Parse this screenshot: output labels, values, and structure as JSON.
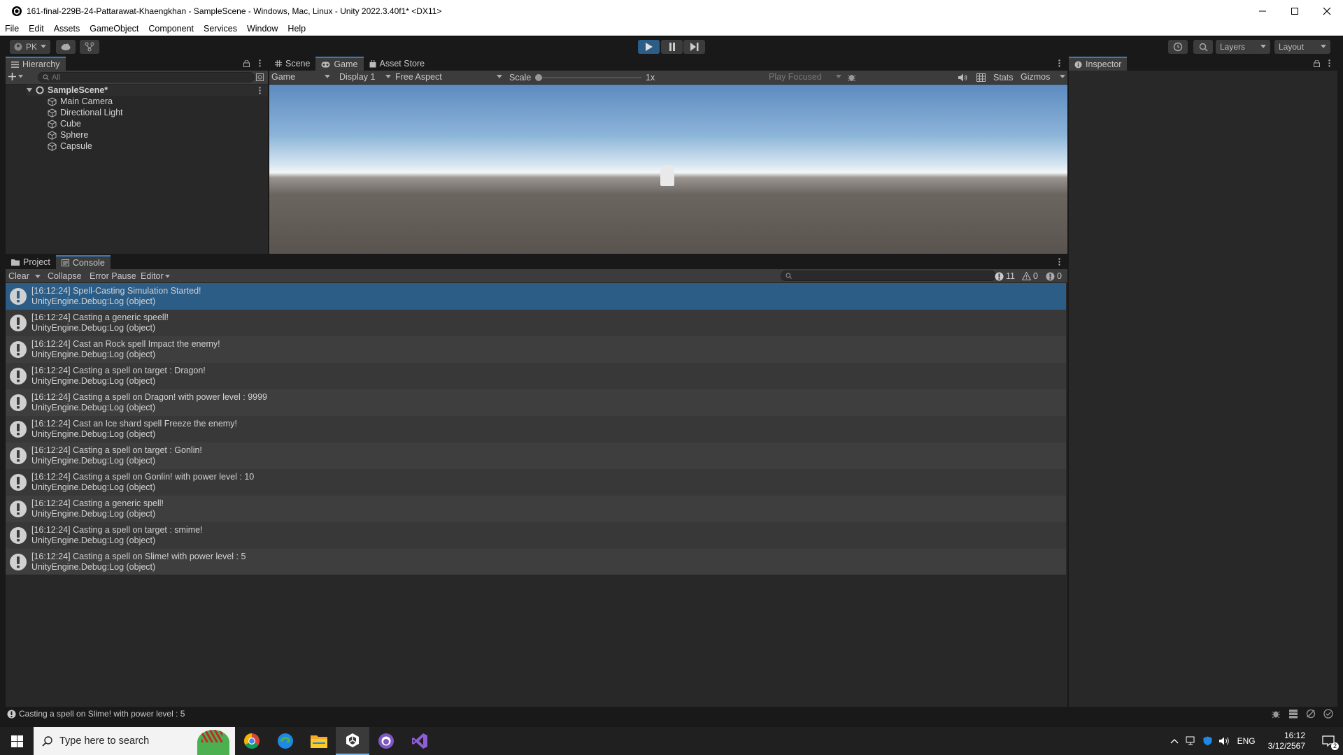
{
  "window": {
    "title": "161-final-229B-24-Pattarawat-Khaengkhan - SampleScene - Windows, Mac, Linux - Unity 2022.3.40f1* <DX11>"
  },
  "menu": [
    "File",
    "Edit",
    "Assets",
    "GameObject",
    "Component",
    "Services",
    "Window",
    "Help"
  ],
  "toolbar": {
    "account": "PK",
    "layers": "Layers",
    "layout": "Layout"
  },
  "hierarchy": {
    "tab": "Hierarchy",
    "search_placeholder": "All",
    "scene": "SampleScene*",
    "objects": [
      "Main Camera",
      "Directional Light",
      "Cube",
      "Sphere",
      "Capsule"
    ]
  },
  "center_tabs": [
    "Scene",
    "Game",
    "Asset Store"
  ],
  "game_toolbar": {
    "mode": "Game",
    "display": "Display 1",
    "aspect": "Free Aspect",
    "scale_label": "Scale",
    "scale_value": "1x",
    "play_focused": "Play Focused",
    "stats": "Stats",
    "gizmos": "Gizmos"
  },
  "inspector": {
    "tab": "Inspector"
  },
  "bottom_tabs": [
    "Project",
    "Console"
  ],
  "console_toolbar": {
    "clear": "Clear",
    "collapse": "Collapse",
    "error_pause": "Error Pause",
    "editor": "Editor",
    "log_count": "11",
    "warn_count": "0",
    "error_count": "0"
  },
  "console_entries": [
    {
      "message": "[16:12:24] Spell-Casting Simulation Started!",
      "source": "UnityEngine.Debug:Log (object)"
    },
    {
      "message": "[16:12:24] Casting a generic speell!",
      "source": "UnityEngine.Debug:Log (object)"
    },
    {
      "message": "[16:12:24] Cast an Rock spell Impact the enemy!",
      "source": "UnityEngine.Debug:Log (object)"
    },
    {
      "message": "[16:12:24] Casting a spell on target : Dragon!",
      "source": "UnityEngine.Debug:Log (object)"
    },
    {
      "message": "[16:12:24] Casting a spell on Dragon! with power level : 9999",
      "source": "UnityEngine.Debug:Log (object)"
    },
    {
      "message": "[16:12:24] Cast an Ice shard spell Freeze the enemy!",
      "source": "UnityEngine.Debug:Log (object)"
    },
    {
      "message": "[16:12:24] Casting a spell on target : Gonlin!",
      "source": "UnityEngine.Debug:Log (object)"
    },
    {
      "message": "[16:12:24] Casting a spell on Gonlin! with power level : 10",
      "source": "UnityEngine.Debug:Log (object)"
    },
    {
      "message": "[16:12:24] Casting a generic spell!",
      "source": "UnityEngine.Debug:Log (object)"
    },
    {
      "message": "[16:12:24] Casting a spell on target : smime!",
      "source": "UnityEngine.Debug:Log (object)"
    },
    {
      "message": "[16:12:24] Casting a spell on Slime! with power level : 5",
      "source": "UnityEngine.Debug:Log (object)"
    }
  ],
  "status_bar": {
    "message": "Casting a spell on Slime! with power level : 5"
  },
  "taskbar": {
    "search_placeholder": "Type here to search",
    "language": "ENG",
    "time": "16:12",
    "date": "3/12/2567",
    "notification_count": "2"
  },
  "colors": {
    "selection": "#2c5d87",
    "accent": "#3a79bb",
    "panel": "#282828",
    "toolbar": "#3c3c3c"
  }
}
